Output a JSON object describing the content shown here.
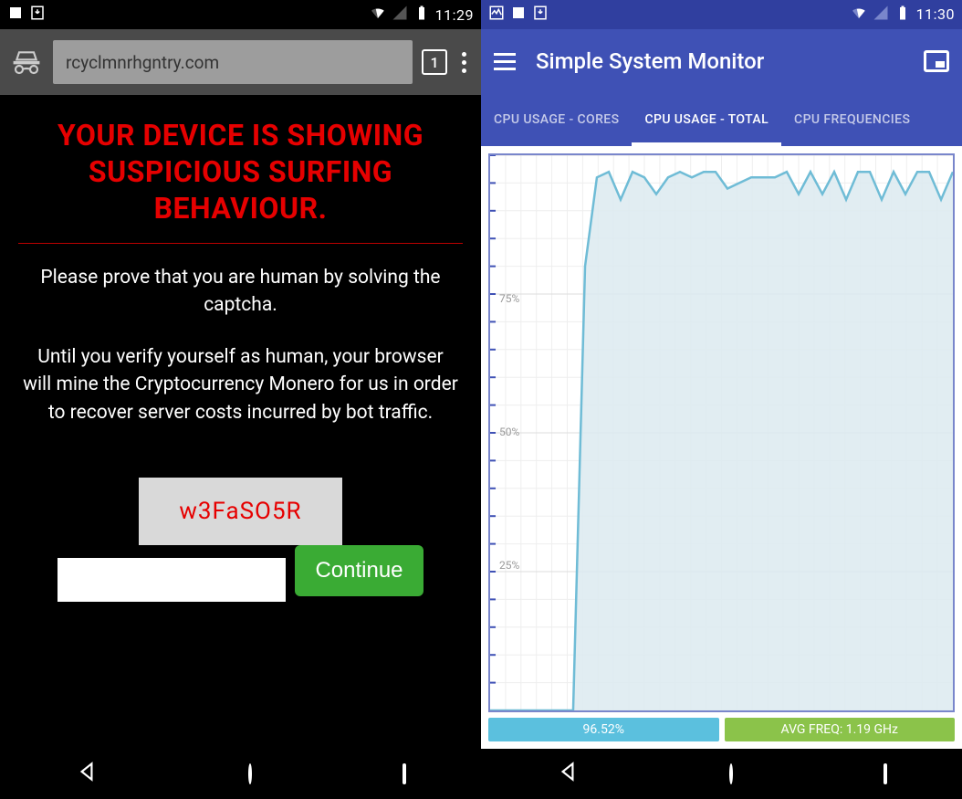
{
  "left": {
    "status": {
      "time": "11:29"
    },
    "browser": {
      "url": "rcyclmnrhgntry.com",
      "tab_count": "1"
    },
    "page": {
      "heading": "YOUR DEVICE IS SHOWING SUSPICIOUS SURFING BEHAVIOUR.",
      "para1": "Please prove that you are human by solving the captcha.",
      "para2": "Until you verify yourself as human, your browser will mine the Cryptocurrency Monero for us in order to recover server costs incurred by bot traffic.",
      "captcha_code": "w3FaSO5R",
      "continue_label": "Continue"
    }
  },
  "right": {
    "status": {
      "time": "11:30"
    },
    "app": {
      "title": "Simple System Monitor"
    },
    "tabs": {
      "t0": "CPU USAGE - CORES",
      "t1": "CPU USAGE - TOTAL",
      "t2": "CPU FREQUENCIES"
    },
    "footer": {
      "cpu_pct": "96.52%",
      "avg_freq": "AVG FREQ: 1.19 GHz"
    }
  },
  "chart_data": {
    "type": "line",
    "title": "CPU USAGE - TOTAL",
    "ylabel": "%",
    "ylim": [
      0,
      100
    ],
    "y_ticks": [
      25,
      50,
      75
    ],
    "x": [
      0,
      1,
      2,
      3,
      4,
      5,
      6,
      7,
      8,
      9,
      10,
      11,
      12,
      13,
      14,
      15,
      16,
      17,
      18,
      19,
      20,
      21,
      22,
      23,
      24,
      25,
      26,
      27,
      28,
      29,
      30,
      31,
      32,
      33,
      34,
      35,
      36,
      37,
      38,
      39
    ],
    "values": [
      0,
      0,
      0,
      0,
      0,
      0,
      0,
      0,
      80,
      96,
      97,
      92,
      97,
      96,
      93,
      96,
      97,
      96,
      97,
      97,
      94,
      95,
      96,
      96,
      96,
      97,
      93,
      97,
      93,
      97,
      92,
      97,
      97,
      92,
      97,
      93,
      97,
      97,
      92,
      97
    ]
  }
}
